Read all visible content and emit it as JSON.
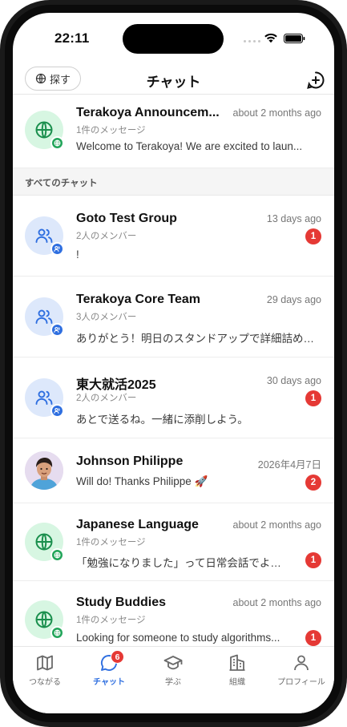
{
  "status_bar": {
    "time": "22:11"
  },
  "header": {
    "search_label": "探す",
    "title": "チャット"
  },
  "pinned_chat": {
    "name": "Terakoya Announcem...",
    "subtitle": "1件のメッセージ",
    "preview": "Welcome to Terakoya! We are excited to laun...",
    "time": "about 2 months ago",
    "avatar_icon": "globe-icon"
  },
  "section_label": "すべてのチャット",
  "chats": [
    {
      "name": "Goto Test Group",
      "subtitle": "2人のメンバー",
      "preview": "!",
      "time": "13 days ago",
      "unread": "1",
      "avatar_icon": "group-icon"
    },
    {
      "name": "Terakoya Core Team",
      "subtitle": "3人のメンバー",
      "preview": "ありがとう！明日のスタンドアップで詳細詰めま…",
      "time": "29 days ago",
      "unread": "",
      "avatar_icon": "group-icon"
    },
    {
      "name": "東大就活2025",
      "subtitle": "2人のメンバー",
      "preview": "あとで送るね。一緒に添削しよう。",
      "time": "30 days ago",
      "unread": "1",
      "avatar_icon": "group-icon"
    },
    {
      "name": "Johnson Philippe",
      "subtitle": "",
      "preview": "Will do! Thanks Philippe 🚀",
      "time": "2026年4月7日",
      "unread": "2",
      "avatar_icon": "user-photo"
    },
    {
      "name": "Japanese Language",
      "subtitle": "1件のメッセージ",
      "preview": "「勉強になりました」って日常会話でよく使…",
      "time": "about 2 months ago",
      "unread": "1",
      "avatar_icon": "globe-icon"
    },
    {
      "name": "Study Buddies",
      "subtitle": "1件のメッセージ",
      "preview": "Looking for someone to study algorithms...",
      "time": "about 2 months ago",
      "unread": "1",
      "avatar_icon": "globe-icon"
    }
  ],
  "tabs": [
    {
      "label": "つながる",
      "icon": "map-icon",
      "active": false
    },
    {
      "label": "チャット",
      "icon": "chat-bubble-icon",
      "active": true,
      "badge": "6"
    },
    {
      "label": "学ぶ",
      "icon": "graduation-cap-icon",
      "active": false
    },
    {
      "label": "組織",
      "icon": "building-icon",
      "active": false
    },
    {
      "label": "プロフィール",
      "icon": "person-icon",
      "active": false
    }
  ],
  "colors": {
    "accent": "#2f6fe0",
    "unread": "#e53935",
    "globe_green": "#22a55a",
    "avatar_green_bg": "#d7f6e2",
    "avatar_blue_bg": "#dde8fb"
  }
}
